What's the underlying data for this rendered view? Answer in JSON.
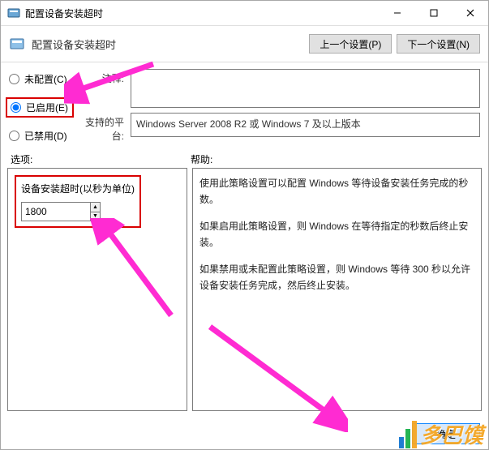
{
  "window": {
    "title": "配置设备安装超时"
  },
  "subheader": {
    "title": "配置设备安装超时",
    "prev_label": "上一个设置(P)",
    "next_label": "下一个设置(N)"
  },
  "radios": {
    "not_configured": "未配置(C)",
    "enabled": "已启用(E)",
    "disabled": "已禁用(D)",
    "selected": "enabled"
  },
  "fields": {
    "comment_label": "注释:",
    "comment_value": "",
    "platform_label": "支持的平台:",
    "platform_value": "Windows Server 2008 R2 或 Windows 7 及以上版本"
  },
  "sections": {
    "options_label": "选项:",
    "help_label": "帮助:"
  },
  "option": {
    "title": "设备安装超时(以秒为单位)",
    "value": "1800"
  },
  "help": {
    "p1": "使用此策略设置可以配置 Windows 等待设备安装任务完成的秒数。",
    "p2": "如果启用此策略设置，则 Windows 在等待指定的秒数后终止安装。",
    "p3": "如果禁用或未配置此策略设置，则 Windows 等待 300 秒以允许设备安装任务完成，然后终止安装。"
  },
  "footer": {
    "ok_label": "确定"
  },
  "watermark": {
    "text": "多巴馍"
  }
}
